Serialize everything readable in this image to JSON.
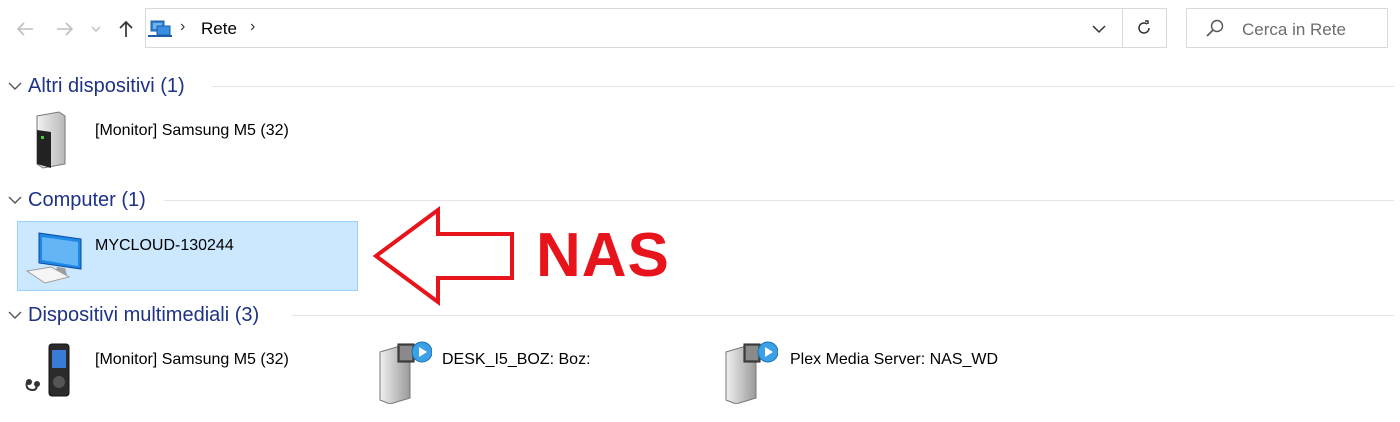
{
  "toolbar": {
    "back_icon": "back-arrow-icon",
    "forward_icon": "forward-arrow-icon",
    "recent_icon": "chevron-down-icon",
    "up_icon": "up-arrow-icon"
  },
  "address_bar": {
    "icon": "network-icon",
    "path": "Rete",
    "dropdown_icon": "chevron-down-icon",
    "refresh_icon": "refresh-icon"
  },
  "search": {
    "placeholder": "Cerca in Rete",
    "icon": "search-icon"
  },
  "groups": [
    {
      "title": "Altri dispositivi (1)",
      "items": [
        {
          "label": "[Monitor] Samsung M5 (32)",
          "icon": "device-tower-icon"
        }
      ]
    },
    {
      "title": "Computer (1)",
      "items": [
        {
          "label": "MYCLOUD-130244",
          "icon": "computer-monitor-icon",
          "selected": true
        }
      ]
    },
    {
      "title": "Dispositivi multimediali (3)",
      "items": [
        {
          "label": "[Monitor] Samsung M5 (32)",
          "icon": "media-player-icon"
        },
        {
          "label": "DESK_I5_BOZ: Boz:",
          "icon": "media-server-icon"
        },
        {
          "label": "Plex Media Server: NAS_WD",
          "icon": "media-server-icon"
        }
      ]
    }
  ],
  "annotation": {
    "text": "NAS",
    "color": "#e8141c",
    "icon": "left-arrow-outline-icon"
  },
  "colors": {
    "group_title": "#1e3287",
    "selection_bg": "#cce8ff",
    "selection_border": "#99d1ff"
  }
}
